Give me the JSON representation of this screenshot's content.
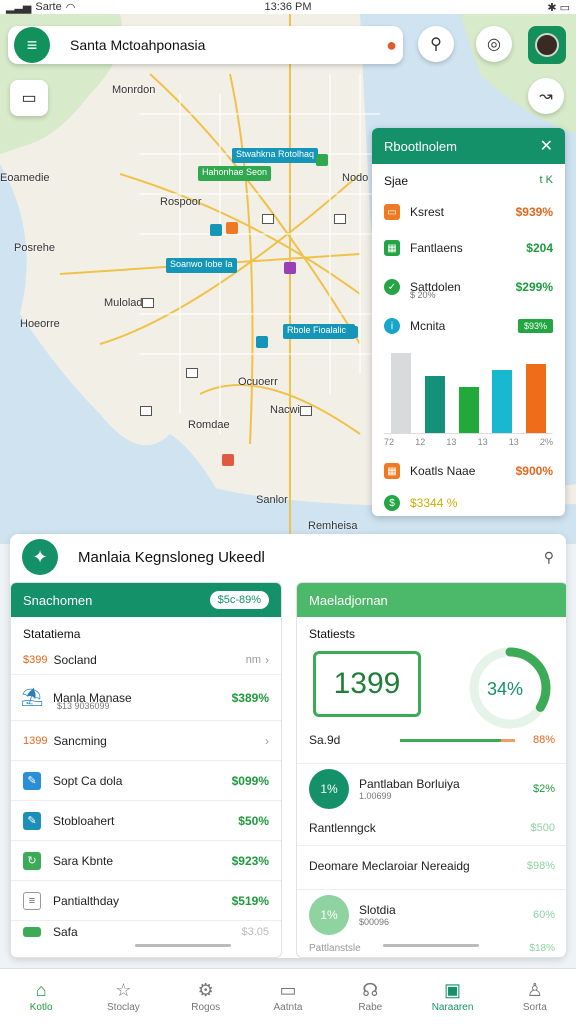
{
  "status_bar": {
    "carrier": "Sarte",
    "time": "13:36 PM"
  },
  "search": {
    "value": "Santa Mctoahponasia"
  },
  "map": {
    "labels": [
      "Monrdon",
      "Rospoor",
      "Nodo",
      "Posrehe",
      "Mulolad",
      "Hoeorre",
      "Ocuoerr",
      "Nacwia",
      "Romdae",
      "Sanlor",
      "Eoamedie",
      "Remheisa"
    ],
    "pins": [
      "Stwahkna Rotolhaq",
      "Hahonhae Seon",
      "Soanwo Iobe Ia",
      "Rbole Fioalalicn"
    ]
  },
  "side_panel": {
    "title": "Rbootlnolem",
    "sub_label": "Sjae",
    "sub_value": "t K",
    "rows": [
      {
        "label": "Ksrest",
        "value": "$939%"
      },
      {
        "label": "Fantlaens",
        "value": "$204"
      },
      {
        "label": "Sattdolen",
        "sub": "$ 20%",
        "value": "$299%"
      },
      {
        "label": "Mcnita",
        "value": "$93%"
      }
    ],
    "chart_data": {
      "type": "bar",
      "categories": [
        "72",
        "12",
        "13",
        "13",
        "13"
      ],
      "values": [
        70,
        50,
        40,
        55,
        60
      ],
      "ylim": [
        0,
        75
      ],
      "colors": [
        "#d8dadc",
        "#15917a",
        "#23a83a",
        "#17b8d0",
        "#ef6c1a"
      ]
    },
    "ticks": [
      "72",
      "12",
      "13",
      "13",
      "13",
      "2%"
    ],
    "footer_label": "Koatls Naae",
    "footer_value": "$900%",
    "footer_green": "$3344 %"
  },
  "dashboard": {
    "title": "Manlaia Kegnsloneg Ukeedl",
    "left": {
      "header": "Snachomen",
      "pill": "$5c-89%",
      "stat_label": "Statatiema",
      "rows": [
        {
          "pre": "$399",
          "label": "Socland",
          "value": "nm",
          "chev": true
        },
        {
          "label": "Manla Manase",
          "sub": "$13 9036099",
          "value": "$389%"
        },
        {
          "pre": "1399",
          "label": "Sancming",
          "value": "",
          "chev": true
        },
        {
          "label": "Sopt Ca dola",
          "value": "$099%"
        },
        {
          "label": "Stobloahert",
          "value": "$50%"
        },
        {
          "label": "Sara Kbnte",
          "value": "$923%"
        },
        {
          "label": "Pantialthday",
          "value": "$519%"
        },
        {
          "label": "Safa",
          "value": "$3.05"
        }
      ]
    },
    "right": {
      "header": "Maeladjornan",
      "stat_label": "Statiests",
      "big_number": "1399",
      "ring_percent": 34,
      "ring_label": "34%",
      "progress_label": "Sa.9d",
      "progress_percent": 88,
      "progress_value": "88%",
      "rows": [
        {
          "circle": "1%",
          "label": "Pantlaban Borluiya",
          "sub": "1.00699",
          "value": "$2%"
        },
        {
          "label": "Rantlenngck",
          "value": "$500"
        },
        {
          "label": "Deomare Meclaroiar Nereaidg",
          "value": "$98%"
        },
        {
          "circle": "1%",
          "label": "Slotdia",
          "sub": "$00096",
          "value": "60%"
        },
        {
          "label": "Pattlanstsle",
          "value": "$18%"
        }
      ]
    }
  },
  "nav": [
    "Kotlo",
    "Stoclay",
    "Rogos",
    "Aatnta",
    "Rabe",
    "Naraaren",
    "Sorta"
  ]
}
